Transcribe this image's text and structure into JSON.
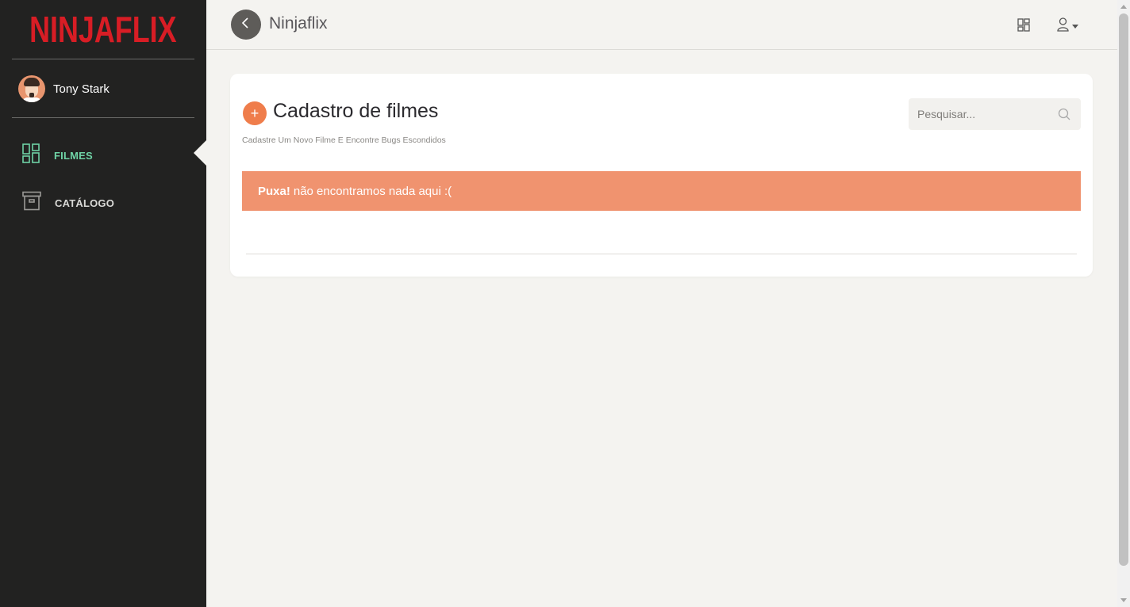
{
  "sidebar": {
    "logo": "NINJAFLIX",
    "user": {
      "name": "Tony Stark"
    },
    "items": [
      {
        "label": "FILMES",
        "icon": "dashboard-icon",
        "active": true
      },
      {
        "label": "CATÁLOGO",
        "icon": "archive-box-icon",
        "active": false
      }
    ]
  },
  "header": {
    "title": "Ninjaflix",
    "icons": [
      "back-arrow-icon",
      "grid-icon",
      "user-icon",
      "caret-down-icon"
    ]
  },
  "main": {
    "title": "Cadastro de filmes",
    "subtitle": "Cadastre Um Novo Filme E Encontre Bugs Escondidos",
    "add_label": "+",
    "search": {
      "placeholder": "Pesquisar...",
      "value": ""
    },
    "alert": {
      "strong": "Puxa!",
      "message": "não encontramos nada aqui :("
    }
  },
  "colors": {
    "sidebar_bg": "#222221",
    "page_bg": "#f4f3f0",
    "logo_red": "#d81d25",
    "active_green": "#6fd3a6",
    "accent_orange": "#ef7d4b",
    "alert_bg": "#f0936f"
  }
}
